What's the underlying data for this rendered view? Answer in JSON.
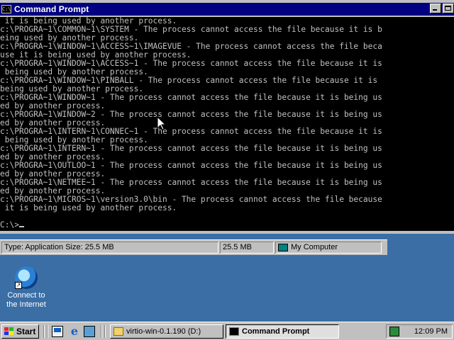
{
  "window": {
    "title": "Command Prompt",
    "icon_text": "C:\\"
  },
  "console": {
    "lines": [
      " it is being used by another process.",
      "c:\\PROGRA~1\\COMMON~1\\SYSTEM - The process cannot access the file because it is b",
      "eing used by another process.",
      "c:\\PROGRA~1\\WINDOW~1\\ACCESS~1\\IMAGEVUE - The process cannot access the file beca",
      "use it is being used by another process.",
      "c:\\PROGRA~1\\WINDOW~1\\ACCESS~1 - The process cannot access the file because it is",
      " being used by another process.",
      "c:\\PROGRA~1\\WINDOW~1\\PINBALL - The process cannot access the file because it is",
      "being used by another process.",
      "c:\\PROGRA~1\\WINDOW~1 - The process cannot access the file because it is being us",
      "ed by another process.",
      "c:\\PROGRA~1\\WINDOW~2 - The process cannot access the file because it is being us",
      "ed by another process.",
      "c:\\PROGRA~1\\INTERN~1\\CONNEC~1 - The process cannot access the file because it is",
      " being used by another process.",
      "c:\\PROGRA~1\\INTERN~1 - The process cannot access the file because it is being us",
      "ed by another process.",
      "c:\\PROGRA~1\\OUTLOO~1 - The process cannot access the file because it is being us",
      "ed by another process.",
      "c:\\PROGRA~1\\NETMEE~1 - The process cannot access the file because it is being us",
      "ed by another process.",
      "c:\\PROGRA~1\\MICROS~1\\version3.0\\bin - The process cannot access the file because",
      " it is being used by another process.",
      "",
      "C:\\>"
    ]
  },
  "statusbar": {
    "type_info": "Type: Application Size: 25.5 MB",
    "size": "25.5 MB",
    "zone": "My Computer"
  },
  "desktop": {
    "icons": [
      {
        "label": "Connect to the Internet",
        "icon": "internet-connection-icon"
      }
    ]
  },
  "taskbar": {
    "start_label": "Start",
    "quick_launch": [
      "show-desktop-icon",
      "internet-explorer-icon",
      "channels-icon"
    ],
    "buttons": [
      {
        "label": "virtio-win-0.1.190 (D:)",
        "icon": "folder-icon",
        "active": false
      },
      {
        "label": "Command Prompt",
        "icon": "cmd-icon",
        "active": true
      }
    ],
    "clock": "12:09 PM"
  },
  "colors": {
    "desktop": "#3a6ea5",
    "titlebar": "#000080",
    "console_bg": "#000000",
    "console_fg": "#c0c0c0",
    "chrome": "#c0c0c0"
  }
}
